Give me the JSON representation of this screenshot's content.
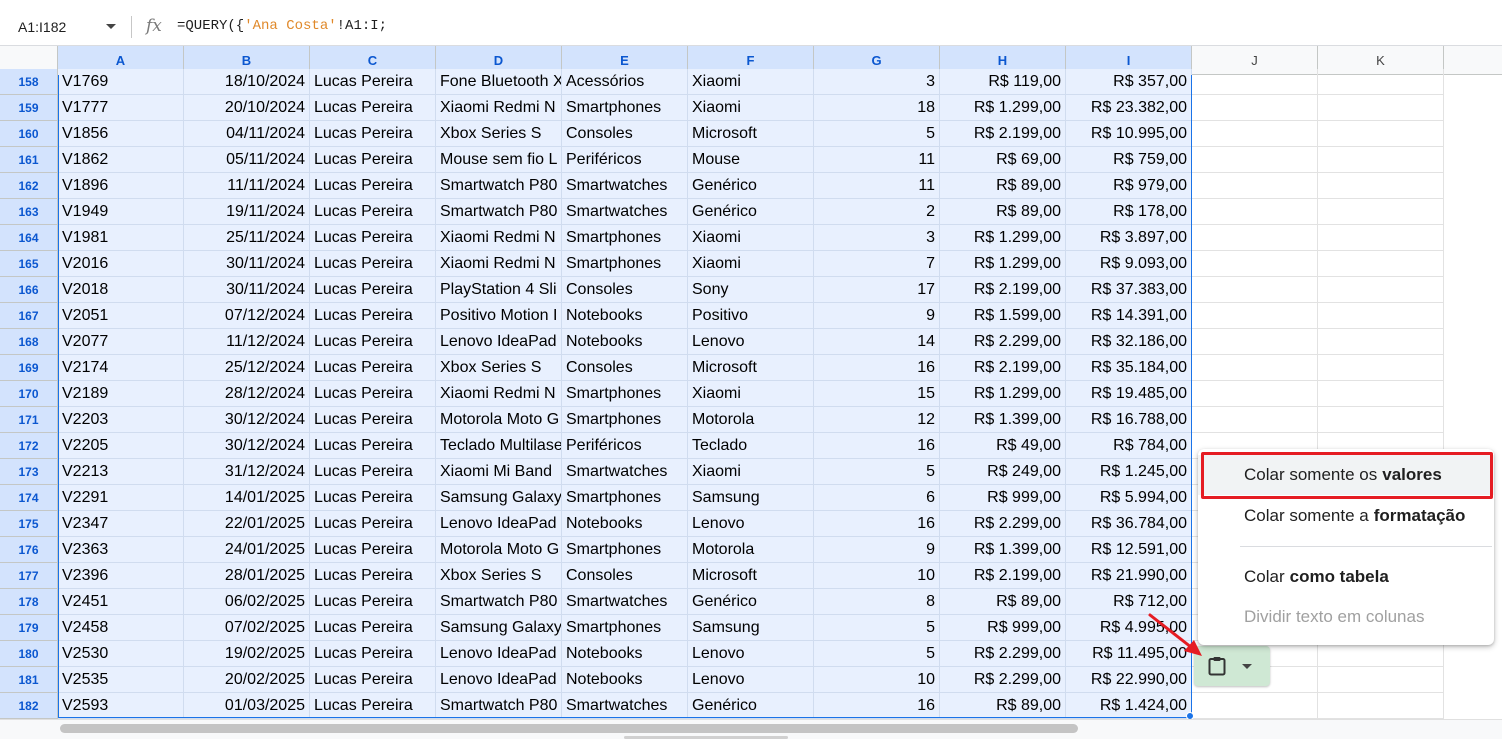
{
  "formula_bar": {
    "name_box": "A1:I182",
    "fx_label": "fx",
    "formula_prefix": "=QUERY({",
    "formula_string": "'Ana Costa'",
    "formula_suffix": "!A1:I;"
  },
  "columns": [
    "A",
    "B",
    "C",
    "D",
    "E",
    "F",
    "G",
    "H",
    "I",
    "J",
    "K"
  ],
  "rows": [
    {
      "n": "158",
      "a": "V1769",
      "b": "18/10/2024",
      "c": "Lucas Pereira",
      "d": "Fone Bluetooth X",
      "e": "Acessórios",
      "f": "Xiaomi",
      "g": "3",
      "h": "R$ 119,00",
      "i": "R$ 357,00"
    },
    {
      "n": "159",
      "a": "V1777",
      "b": "20/10/2024",
      "c": "Lucas Pereira",
      "d": "Xiaomi Redmi N",
      "e": "Smartphones",
      "f": "Xiaomi",
      "g": "18",
      "h": "R$ 1.299,00",
      "i": "R$ 23.382,00"
    },
    {
      "n": "160",
      "a": "V1856",
      "b": "04/11/2024",
      "c": "Lucas Pereira",
      "d": "Xbox Series S",
      "e": "Consoles",
      "f": "Microsoft",
      "g": "5",
      "h": "R$ 2.199,00",
      "i": "R$ 10.995,00"
    },
    {
      "n": "161",
      "a": "V1862",
      "b": "05/11/2024",
      "c": "Lucas Pereira",
      "d": "Mouse sem fio L",
      "e": "Periféricos",
      "f": "Mouse",
      "g": "11",
      "h": "R$ 69,00",
      "i": "R$ 759,00"
    },
    {
      "n": "162",
      "a": "V1896",
      "b": "11/11/2024",
      "c": "Lucas Pereira",
      "d": "Smartwatch P80",
      "e": "Smartwatches",
      "f": "Genérico",
      "g": "11",
      "h": "R$ 89,00",
      "i": "R$ 979,00"
    },
    {
      "n": "163",
      "a": "V1949",
      "b": "19/11/2024",
      "c": "Lucas Pereira",
      "d": "Smartwatch P80",
      "e": "Smartwatches",
      "f": "Genérico",
      "g": "2",
      "h": "R$ 89,00",
      "i": "R$ 178,00"
    },
    {
      "n": "164",
      "a": "V1981",
      "b": "25/11/2024",
      "c": "Lucas Pereira",
      "d": "Xiaomi Redmi N",
      "e": "Smartphones",
      "f": "Xiaomi",
      "g": "3",
      "h": "R$ 1.299,00",
      "i": "R$ 3.897,00"
    },
    {
      "n": "165",
      "a": "V2016",
      "b": "30/11/2024",
      "c": "Lucas Pereira",
      "d": "Xiaomi Redmi N",
      "e": "Smartphones",
      "f": "Xiaomi",
      "g": "7",
      "h": "R$ 1.299,00",
      "i": "R$ 9.093,00"
    },
    {
      "n": "166",
      "a": "V2018",
      "b": "30/11/2024",
      "c": "Lucas Pereira",
      "d": "PlayStation 4 Sli",
      "e": "Consoles",
      "f": "Sony",
      "g": "17",
      "h": "R$ 2.199,00",
      "i": "R$ 37.383,00"
    },
    {
      "n": "167",
      "a": "V2051",
      "b": "07/12/2024",
      "c": "Lucas Pereira",
      "d": "Positivo Motion I",
      "e": "Notebooks",
      "f": "Positivo",
      "g": "9",
      "h": "R$ 1.599,00",
      "i": "R$ 14.391,00"
    },
    {
      "n": "168",
      "a": "V2077",
      "b": "11/12/2024",
      "c": "Lucas Pereira",
      "d": "Lenovo IdeaPad",
      "e": "Notebooks",
      "f": "Lenovo",
      "g": "14",
      "h": "R$ 2.299,00",
      "i": "R$ 32.186,00"
    },
    {
      "n": "169",
      "a": "V2174",
      "b": "25/12/2024",
      "c": "Lucas Pereira",
      "d": "Xbox Series S",
      "e": "Consoles",
      "f": "Microsoft",
      "g": "16",
      "h": "R$ 2.199,00",
      "i": "R$ 35.184,00"
    },
    {
      "n": "170",
      "a": "V2189",
      "b": "28/12/2024",
      "c": "Lucas Pereira",
      "d": "Xiaomi Redmi N",
      "e": "Smartphones",
      "f": "Xiaomi",
      "g": "15",
      "h": "R$ 1.299,00",
      "i": "R$ 19.485,00"
    },
    {
      "n": "171",
      "a": "V2203",
      "b": "30/12/2024",
      "c": "Lucas Pereira",
      "d": "Motorola Moto G",
      "e": "Smartphones",
      "f": "Motorola",
      "g": "12",
      "h": "R$ 1.399,00",
      "i": "R$ 16.788,00"
    },
    {
      "n": "172",
      "a": "V2205",
      "b": "30/12/2024",
      "c": "Lucas Pereira",
      "d": "Teclado Multilase",
      "e": "Periféricos",
      "f": "Teclado",
      "g": "16",
      "h": "R$ 49,00",
      "i": "R$ 784,00"
    },
    {
      "n": "173",
      "a": "V2213",
      "b": "31/12/2024",
      "c": "Lucas Pereira",
      "d": "Xiaomi Mi Band",
      "e": "Smartwatches",
      "f": "Xiaomi",
      "g": "5",
      "h": "R$ 249,00",
      "i": "R$ 1.245,00"
    },
    {
      "n": "174",
      "a": "V2291",
      "b": "14/01/2025",
      "c": "Lucas Pereira",
      "d": "Samsung Galaxy",
      "e": "Smartphones",
      "f": "Samsung",
      "g": "6",
      "h": "R$ 999,00",
      "i": "R$ 5.994,00"
    },
    {
      "n": "175",
      "a": "V2347",
      "b": "22/01/2025",
      "c": "Lucas Pereira",
      "d": "Lenovo IdeaPad",
      "e": "Notebooks",
      "f": "Lenovo",
      "g": "16",
      "h": "R$ 2.299,00",
      "i": "R$ 36.784,00"
    },
    {
      "n": "176",
      "a": "V2363",
      "b": "24/01/2025",
      "c": "Lucas Pereira",
      "d": "Motorola Moto G",
      "e": "Smartphones",
      "f": "Motorola",
      "g": "9",
      "h": "R$ 1.399,00",
      "i": "R$ 12.591,00"
    },
    {
      "n": "177",
      "a": "V2396",
      "b": "28/01/2025",
      "c": "Lucas Pereira",
      "d": "Xbox Series S",
      "e": "Consoles",
      "f": "Microsoft",
      "g": "10",
      "h": "R$ 2.199,00",
      "i": "R$ 21.990,00"
    },
    {
      "n": "178",
      "a": "V2451",
      "b": "06/02/2025",
      "c": "Lucas Pereira",
      "d": "Smartwatch P80",
      "e": "Smartwatches",
      "f": "Genérico",
      "g": "8",
      "h": "R$ 89,00",
      "i": "R$ 712,00"
    },
    {
      "n": "179",
      "a": "V2458",
      "b": "07/02/2025",
      "c": "Lucas Pereira",
      "d": "Samsung Galaxy",
      "e": "Smartphones",
      "f": "Samsung",
      "g": "5",
      "h": "R$ 999,00",
      "i": "R$ 4.995,00"
    },
    {
      "n": "180",
      "a": "V2530",
      "b": "19/02/2025",
      "c": "Lucas Pereira",
      "d": "Lenovo IdeaPad",
      "e": "Notebooks",
      "f": "Lenovo",
      "g": "5",
      "h": "R$ 2.299,00",
      "i": "R$ 11.495,00"
    },
    {
      "n": "181",
      "a": "V2535",
      "b": "20/02/2025",
      "c": "Lucas Pereira",
      "d": "Lenovo IdeaPad",
      "e": "Notebooks",
      "f": "Lenovo",
      "g": "10",
      "h": "R$ 2.299,00",
      "i": "R$ 22.990,00"
    },
    {
      "n": "182",
      "a": "V2593",
      "b": "01/03/2025",
      "c": "Lucas Pereira",
      "d": "Smartwatch P80",
      "e": "Smartwatches",
      "f": "Genérico",
      "g": "16",
      "h": "R$ 89,00",
      "i": "R$ 1.424,00"
    }
  ],
  "paste_menu": {
    "values": {
      "prefix": "Colar somente os",
      "bold": "valores"
    },
    "format": {
      "prefix": "Colar somente a",
      "bold": "formatação"
    },
    "table": {
      "prefix": "Colar",
      "bold": "como tabela"
    },
    "split": "Dividir texto em colunas"
  },
  "icons": {
    "paste": "clipboard-icon",
    "dropdown": "chevron-down-icon",
    "fx": "function-icon"
  },
  "colors": {
    "selection_fill": "#e8f0fe",
    "selection_header": "#d3e3fd",
    "selection_border": "#1a73e8",
    "paste_chip": "#cfe8d4",
    "annotation_red": "#e51c23"
  }
}
